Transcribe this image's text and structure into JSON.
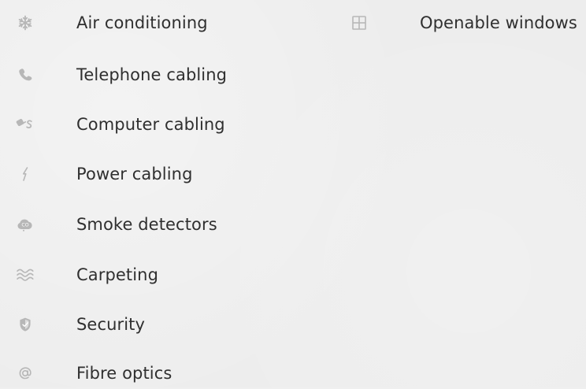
{
  "features": {
    "left": [
      {
        "label": "Air conditioning",
        "icon": "snowflake-icon"
      },
      {
        "label": "Telephone cabling",
        "icon": "phone-icon"
      },
      {
        "label": "Computer cabling",
        "icon": "computer-cable-icon"
      },
      {
        "label": "Power cabling",
        "icon": "lightning-icon"
      },
      {
        "label": "Smoke detectors",
        "icon": "co-smoke-icon"
      },
      {
        "label": "Carpeting",
        "icon": "waves-icon"
      },
      {
        "label": "Security",
        "icon": "shield-icon"
      },
      {
        "label": "Fibre optics",
        "icon": "at-icon"
      }
    ],
    "right": [
      {
        "label": "Openable windows",
        "icon": "window-grid-icon"
      }
    ]
  },
  "colors": {
    "icon": "#b7b7b7",
    "text": "#2f2f2f",
    "background": "#ededed"
  }
}
